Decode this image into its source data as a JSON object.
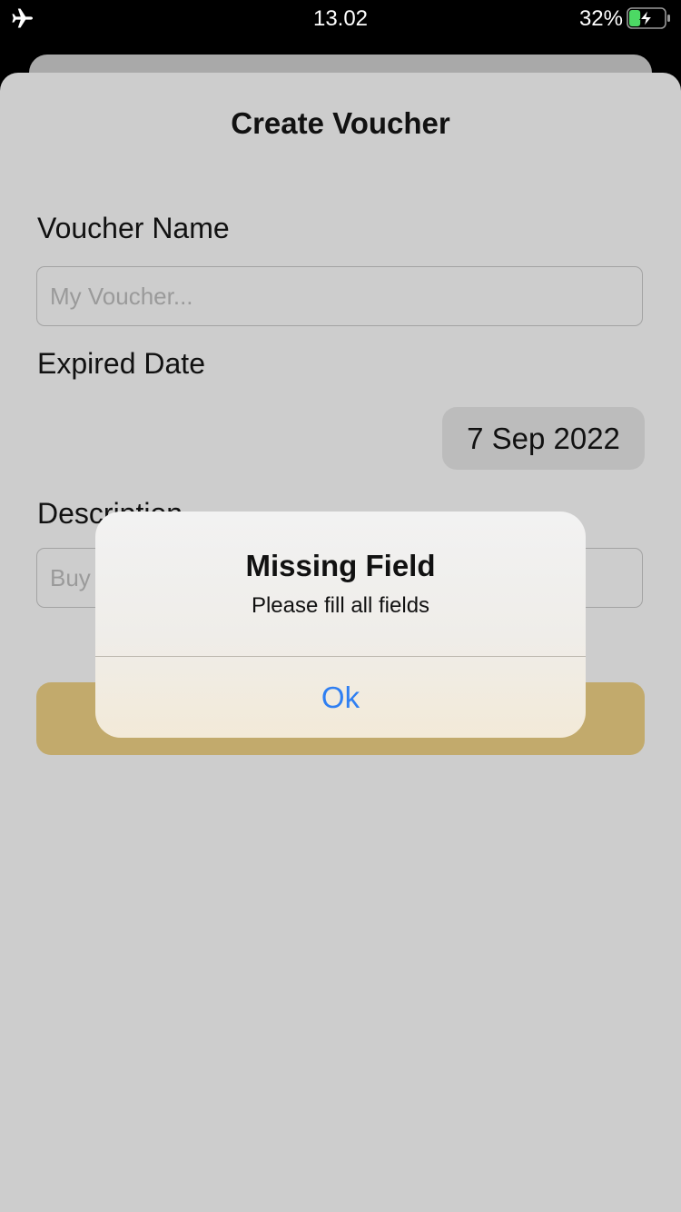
{
  "status_bar": {
    "time": "13.02",
    "battery_percent": "32%",
    "airplane_icon": "airplane-icon",
    "battery_icon": "battery-charging-icon",
    "battery_level": 0.32,
    "battery_fill_color": "#4cd964"
  },
  "form": {
    "title": "Create Voucher",
    "voucher_name_label": "Voucher Name",
    "voucher_name_placeholder": "My Voucher...",
    "expired_date_label": "Expired Date",
    "expired_date_value": "7 Sep 2022",
    "description_label": "Description",
    "description_placeholder": "Buy",
    "submit_button_color": "#c2aa6c"
  },
  "alert": {
    "title": "Missing Field",
    "message": "Please fill all fields",
    "ok_label": "Ok",
    "ok_color": "#2f7ff2"
  }
}
